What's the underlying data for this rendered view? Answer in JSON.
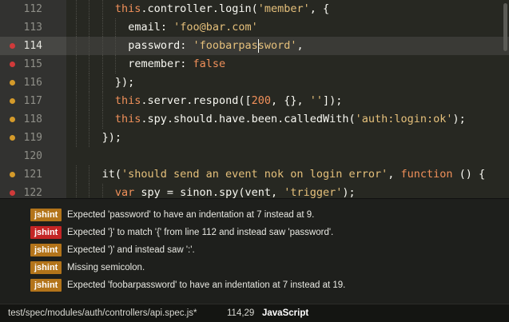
{
  "colors": {
    "error_marker": "#d03a3a",
    "warning_marker": "#d49a2a",
    "badge_warning": "#b3741a",
    "badge_error": "#c42525",
    "keyword": "#f0905a",
    "string": "#e5c07b"
  },
  "editor": {
    "lines": [
      {
        "number": "112",
        "marker": "none",
        "current": false,
        "indent": 3,
        "tokens": [
          {
            "t": "this",
            "c": "kw"
          },
          {
            "t": ".controller.login("
          },
          {
            "t": "'member'",
            "c": "str"
          },
          {
            "t": ", {"
          }
        ]
      },
      {
        "number": "113",
        "marker": "none",
        "current": false,
        "indent": 4,
        "tokens": [
          {
            "t": "email: "
          },
          {
            "t": "'foo@bar.com'",
            "c": "str"
          }
        ]
      },
      {
        "number": "114",
        "marker": "error",
        "current": true,
        "indent": 4,
        "tokens": [
          {
            "t": "password: "
          },
          {
            "t": "'foobarpassword'",
            "c": "str"
          },
          {
            "t": ","
          }
        ]
      },
      {
        "number": "115",
        "marker": "error",
        "current": false,
        "indent": 4,
        "tokens": [
          {
            "t": "remember: "
          },
          {
            "t": "false",
            "c": "kw"
          }
        ]
      },
      {
        "number": "116",
        "marker": "warning",
        "current": false,
        "indent": 3,
        "tokens": [
          {
            "t": "});"
          }
        ]
      },
      {
        "number": "117",
        "marker": "warning",
        "current": false,
        "indent": 3,
        "tokens": [
          {
            "t": "this",
            "c": "kw"
          },
          {
            "t": ".server.respond(["
          },
          {
            "t": "200",
            "c": "num"
          },
          {
            "t": ", {}, "
          },
          {
            "t": "''",
            "c": "str"
          },
          {
            "t": "]);"
          }
        ]
      },
      {
        "number": "118",
        "marker": "warning",
        "current": false,
        "indent": 3,
        "tokens": [
          {
            "t": "this",
            "c": "kw"
          },
          {
            "t": ".spy.should.have.been.calledWith("
          },
          {
            "t": "'auth:login:ok'",
            "c": "str"
          },
          {
            "t": ");"
          }
        ]
      },
      {
        "number": "119",
        "marker": "warning",
        "current": false,
        "indent": 2,
        "tokens": [
          {
            "t": "});"
          }
        ]
      },
      {
        "number": "120",
        "marker": "none",
        "current": false,
        "indent": 0,
        "tokens": []
      },
      {
        "number": "121",
        "marker": "warning",
        "current": false,
        "indent": 2,
        "tokens": [
          {
            "t": "it("
          },
          {
            "t": "'should send an event nok on login error'",
            "c": "str"
          },
          {
            "t": ", "
          },
          {
            "t": "function",
            "c": "kw"
          },
          {
            "t": " () {"
          }
        ]
      },
      {
        "number": "122",
        "marker": "error",
        "current": false,
        "indent": 3,
        "tokens": [
          {
            "t": "var",
            "c": "kw"
          },
          {
            "t": " spy = sinon.spy(vent, "
          },
          {
            "t": "'trigger'",
            "c": "str"
          },
          {
            "t": ");"
          }
        ]
      }
    ]
  },
  "lint_panel": {
    "messages": [
      {
        "badge": "jshint",
        "level": "warning",
        "text": "Expected 'password' to have an indentation at 7 instead at 9."
      },
      {
        "badge": "jshint",
        "level": "error",
        "text": "Expected '}' to match '{' from line 112 and instead saw 'password'."
      },
      {
        "badge": "jshint",
        "level": "warning",
        "text": "Expected ')' and instead saw ':'."
      },
      {
        "badge": "jshint",
        "level": "warning",
        "text": "Missing semicolon."
      },
      {
        "badge": "jshint",
        "level": "warning",
        "text": "Expected 'foobarpassword' to have an indentation at 7 instead at 19."
      }
    ]
  },
  "status_bar": {
    "file_path": "test/spec/modules/auth/controllers/api.spec.js*",
    "cursor_position": "114,29",
    "language": "JavaScript"
  }
}
